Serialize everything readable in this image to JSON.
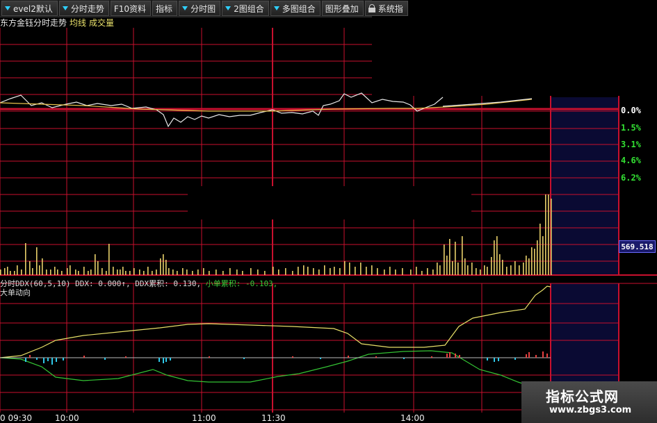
{
  "toolbar": {
    "buttons": [
      {
        "label": "evel2默认",
        "arrow": true
      },
      {
        "label": "分时走势",
        "arrow": true
      },
      {
        "label": "F10资料",
        "arrow": false
      },
      {
        "label": "指标",
        "arrow": false
      },
      {
        "label": "分时图",
        "arrow": true
      },
      {
        "label": "2图组合",
        "arrow": true
      },
      {
        "label": "多图组合",
        "arrow": true
      },
      {
        "label": "图形叠加",
        "arrow": false
      },
      {
        "label": "系统指",
        "arrow": false,
        "lock": true
      }
    ]
  },
  "price_panel": {
    "title": "东方金钰分时走势",
    "avg_label": "均线",
    "vol_label": "成交量",
    "pct_labels": [
      {
        "text": "0.0%",
        "color": "#ffffff"
      },
      {
        "text": "1.5%",
        "color": "#33e033"
      },
      {
        "text": "3.1%",
        "color": "#33e033"
      },
      {
        "text": "4.6%",
        "color": "#33e033"
      },
      {
        "text": "6.2%",
        "color": "#33e033"
      }
    ]
  },
  "volume_panel": {
    "current_value": "569.518"
  },
  "ddx_panel": {
    "title": "分时DDX(60,5,10)",
    "ddx": "DDX: 0.000↑,",
    "ddx_cum": "DDX累积: 0.130,",
    "small_cum": "小单累积: -0.103,",
    "subtitle": "大单动向"
  },
  "time_axis": [
    "0 09:30",
    "10:00",
    "11:00",
    "11:30",
    "14:00"
  ],
  "watermark": {
    "cn": "指标公式网",
    "url": "www.zbgs3.com"
  },
  "colors": {
    "grid": "#c8102e",
    "price_line": "#e8e8e8",
    "avg_line": "#e8c04a",
    "volume_bar": "#e8d06a",
    "ddx_green": "#34c434",
    "ddx_yellow": "#e8e068",
    "future_bg": "#0a0a33"
  }
}
